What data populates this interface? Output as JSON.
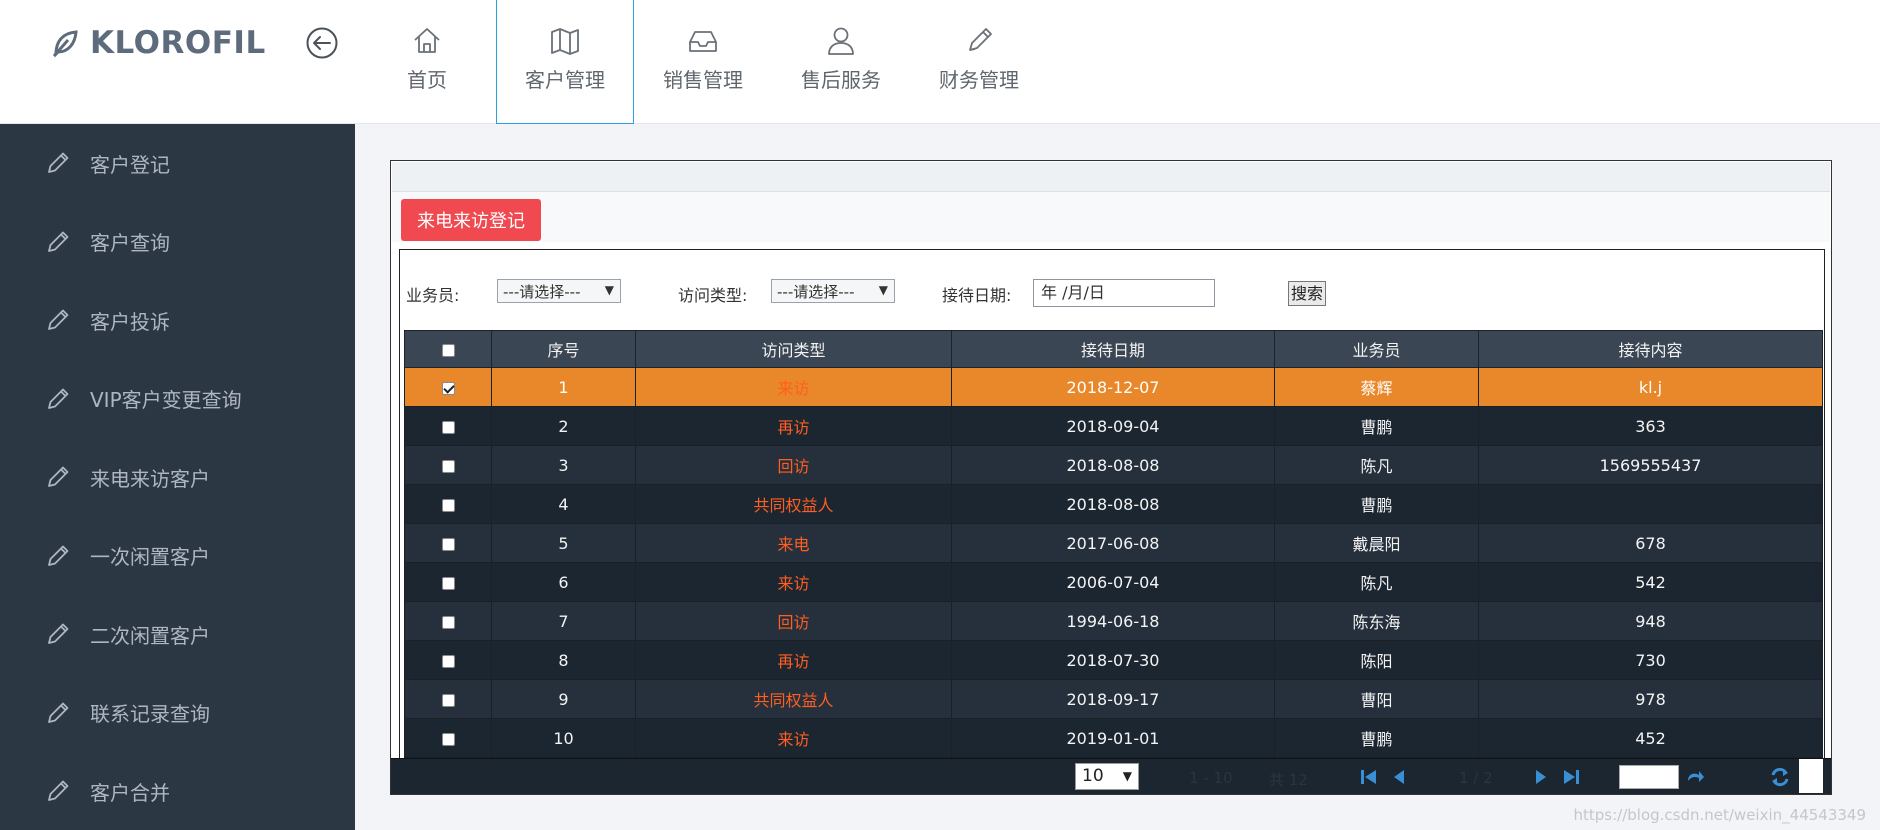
{
  "brand": {
    "name": "KLOROFIL"
  },
  "nav": {
    "items": [
      {
        "label": "首页",
        "icon": "home-icon"
      },
      {
        "label": "客户管理",
        "icon": "map-icon",
        "active": true
      },
      {
        "label": "销售管理",
        "icon": "inbox-icon"
      },
      {
        "label": "售后服务",
        "icon": "user-icon"
      },
      {
        "label": "财务管理",
        "icon": "pencil-icon"
      }
    ]
  },
  "sidebar": {
    "items": [
      {
        "label": "客户登记"
      },
      {
        "label": "客户查询"
      },
      {
        "label": "客户投诉"
      },
      {
        "label": "VIP客户变更查询"
      },
      {
        "label": "来电来访客户"
      },
      {
        "label": "一次闲置客户"
      },
      {
        "label": "二次闲置客户"
      },
      {
        "label": "联系记录查询"
      },
      {
        "label": "客户合并"
      }
    ]
  },
  "toolbar": {
    "register_label": "来电来访登记"
  },
  "filter": {
    "salesman_label": "业务员:",
    "salesman_value": "---请选择---",
    "visit_type_label": "访问类型:",
    "visit_type_value": "---请选择---",
    "date_label": "接待日期:",
    "date_placeholder": "年 /月/日",
    "search_label": "搜索"
  },
  "table": {
    "headers": [
      "序号",
      "访问类型",
      "接待日期",
      "业务员",
      "接待内容"
    ],
    "rows": [
      {
        "no": "1",
        "type": "来访",
        "date": "2018-12-07",
        "salesman": "蔡辉",
        "content": "kl.j",
        "checked": true
      },
      {
        "no": "2",
        "type": "再访",
        "date": "2018-09-04",
        "salesman": "曹鹏",
        "content": "363",
        "checked": false
      },
      {
        "no": "3",
        "type": "回访",
        "date": "2018-08-08",
        "salesman": "陈凡",
        "content": "1569555437",
        "checked": false
      },
      {
        "no": "4",
        "type": "共同权益人",
        "date": "2018-08-08",
        "salesman": "曹鹏",
        "content": "",
        "checked": false
      },
      {
        "no": "5",
        "type": "来电",
        "date": "2017-06-08",
        "salesman": "戴晨阳",
        "content": "678",
        "checked": false
      },
      {
        "no": "6",
        "type": "来访",
        "date": "2006-07-04",
        "salesman": "陈凡",
        "content": "542",
        "checked": false
      },
      {
        "no": "7",
        "type": "回访",
        "date": "1994-06-18",
        "salesman": "陈东海",
        "content": "948",
        "checked": false
      },
      {
        "no": "8",
        "type": "再访",
        "date": "2018-07-30",
        "salesman": "陈阳",
        "content": "730",
        "checked": false
      },
      {
        "no": "9",
        "type": "共同权益人",
        "date": "2018-09-17",
        "salesman": "曹阳",
        "content": "978",
        "checked": false
      },
      {
        "no": "10",
        "type": "来访",
        "date": "2019-01-01",
        "salesman": "曹鹏",
        "content": "452",
        "checked": false
      }
    ]
  },
  "pager": {
    "page_size": "10",
    "range_text": "1 - 10",
    "total_text": "共 12",
    "page_text": "1 / 2"
  },
  "watermark": "https://blog.csdn.net/weixin_44543349",
  "colors": {
    "selected_row": "#e8882a",
    "type_text": "#ff5e20",
    "register_button": "#f04a50",
    "sidebar": "#2c3744"
  }
}
